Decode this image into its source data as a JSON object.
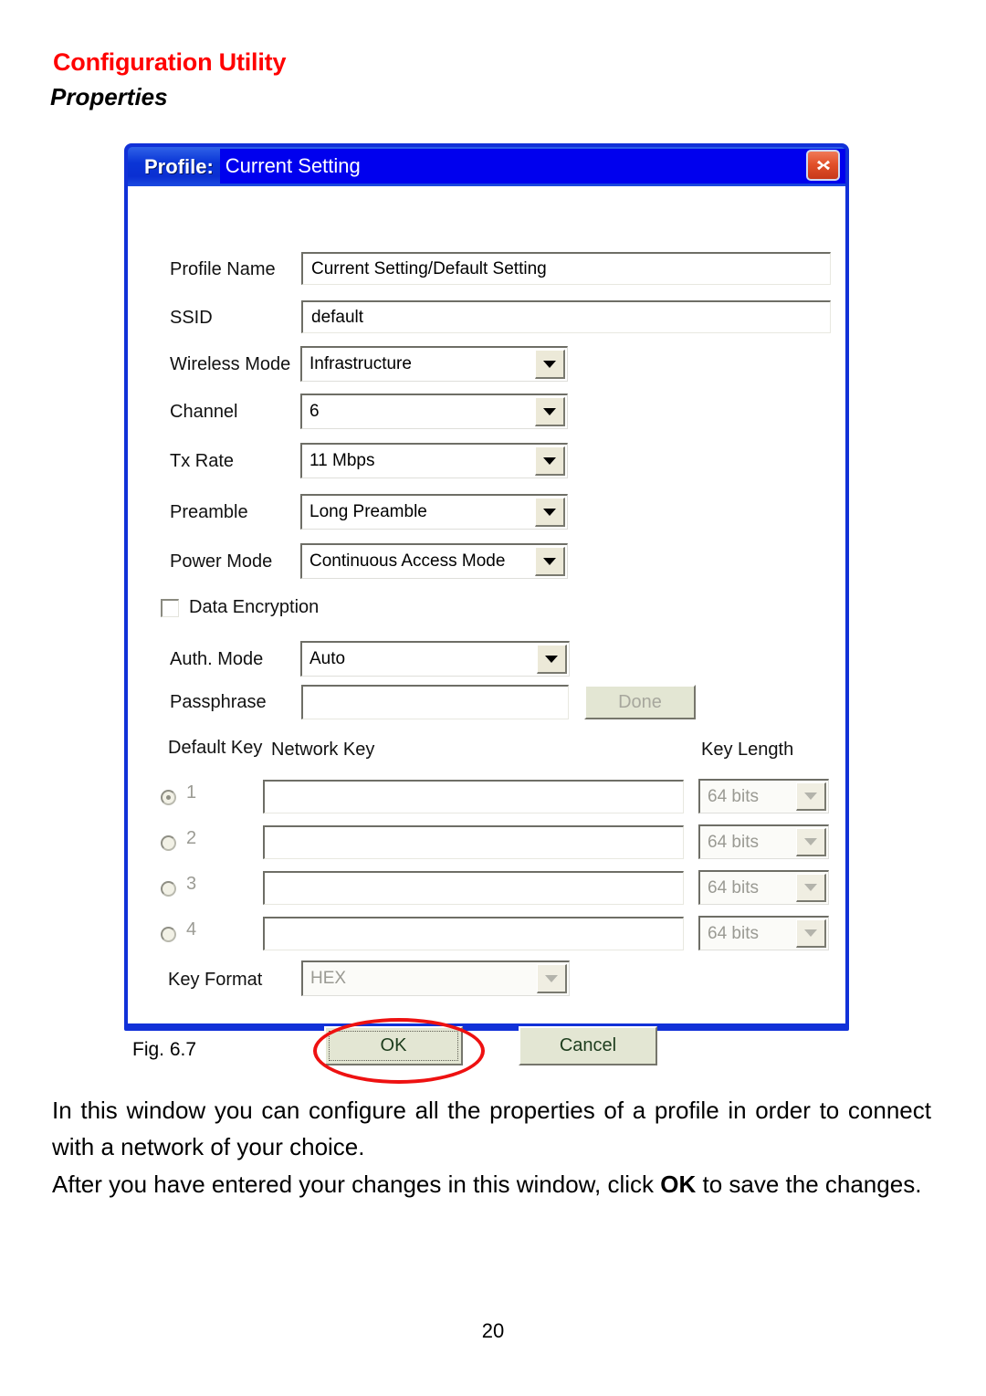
{
  "header": {
    "title": "Configuration Utility",
    "subtitle": "Properties",
    "title_color": "#ff0000"
  },
  "dialog": {
    "titlebar": {
      "label": "Profile:",
      "value": "Current Setting",
      "close_icon": "close-x-icon",
      "bg_color": "#0a2fd2"
    },
    "fields": [
      {
        "label": "Profile Name",
        "value": "Current Setting/Default Setting",
        "type": "text"
      },
      {
        "label": "SSID",
        "value": "default",
        "type": "text"
      },
      {
        "label": "Wireless Mode",
        "value": "Infrastructure",
        "type": "combo"
      },
      {
        "label": "Channel",
        "value": "6",
        "type": "combo"
      },
      {
        "label": "Tx Rate",
        "value": "11 Mbps",
        "type": "combo"
      },
      {
        "label": "Preamble",
        "value": "Long Preamble",
        "type": "combo"
      },
      {
        "label": "Power Mode",
        "value": "Continuous Access Mode",
        "type": "combo"
      }
    ],
    "data_encryption": {
      "label": "Data Encryption",
      "checked": false
    },
    "auth_mode": {
      "label": "Auth. Mode",
      "value": "Auto"
    },
    "passphrase": {
      "label": "Passphrase",
      "value": "",
      "button_label": "Done",
      "button_disabled": true
    },
    "key_headers": {
      "default_key": "Default Key",
      "network_key": "Network Key",
      "key_length": "Key Length"
    },
    "keys": [
      {
        "index": "1",
        "selected": true,
        "network_key": "",
        "key_length": "64 bits"
      },
      {
        "index": "2",
        "selected": false,
        "network_key": "",
        "key_length": "64 bits"
      },
      {
        "index": "3",
        "selected": false,
        "network_key": "",
        "key_length": "64 bits"
      },
      {
        "index": "4",
        "selected": false,
        "network_key": "",
        "key_length": "64 bits"
      }
    ],
    "key_format": {
      "label": "Key Format",
      "value": "HEX",
      "disabled": true
    },
    "buttons": {
      "ok": "OK",
      "cancel": "Cancel"
    },
    "annotation_color": "#ee1111"
  },
  "figure": {
    "caption": "Fig. 6.7"
  },
  "body": {
    "paragraph1": "In this window you can configure all the properties of a profile in order to connect with a network of your choice.",
    "paragraph2_before": "After you have entered your changes in this window, click ",
    "paragraph2_bold": "OK",
    "paragraph2_after": " to save the changes."
  },
  "page_number": "20"
}
